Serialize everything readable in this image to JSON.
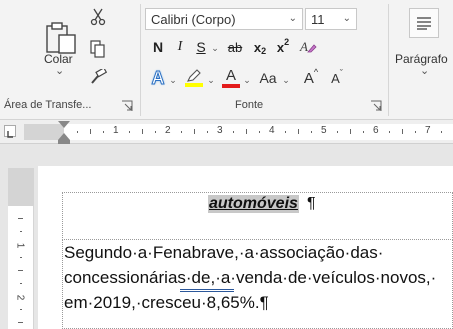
{
  "ribbon": {
    "clipboard": {
      "paste_label": "Colar",
      "group_label": "Área de Transfe...",
      "paste_caret": "⌄"
    },
    "font": {
      "font_name": "Calibri (Corpo)",
      "font_size": "11",
      "group_label": "Fonte",
      "bold": "N",
      "italic": "I",
      "underline": "S",
      "strikethrough": "ab",
      "subscript_base": "x",
      "subscript": "2",
      "superscript_base": "x",
      "superscript": "2",
      "text_effects": "A",
      "font_color": "A",
      "change_case": "Aa",
      "grow_font": "A",
      "shrink_font": "A"
    },
    "paragraph": {
      "label": "Parágrafo",
      "caret": "⌄"
    }
  },
  "ruler": {
    "numbers": [
      "1",
      "2",
      "3",
      "4",
      "5",
      "6",
      "7"
    ]
  },
  "vertical_ruler": {
    "numbers": [
      "1",
      "2"
    ]
  },
  "document": {
    "heading": "automóveis",
    "heading_pilcrow": "¶",
    "lines": [
      "Segundo·a·Fenabrave,·a·associação·das·",
      "concessionárias·de,·a·venda·de·veículos·novos,·",
      "em·2019,·cresceu·8,65%.¶"
    ]
  },
  "colors": {
    "highlight_yellow": "#ffff00",
    "font_red": "#e31b1b",
    "accent_blue": "#2b579a"
  }
}
